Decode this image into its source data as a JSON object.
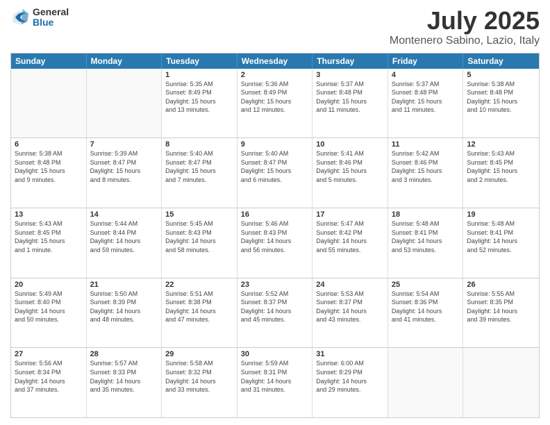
{
  "logo": {
    "general": "General",
    "blue": "Blue"
  },
  "title": "July 2025",
  "location": "Montenero Sabino, Lazio, Italy",
  "weekdays": [
    "Sunday",
    "Monday",
    "Tuesday",
    "Wednesday",
    "Thursday",
    "Friday",
    "Saturday"
  ],
  "weeks": [
    [
      {
        "day": "",
        "info": ""
      },
      {
        "day": "",
        "info": ""
      },
      {
        "day": "1",
        "info": "Sunrise: 5:35 AM\nSunset: 8:49 PM\nDaylight: 15 hours\nand 13 minutes."
      },
      {
        "day": "2",
        "info": "Sunrise: 5:36 AM\nSunset: 8:49 PM\nDaylight: 15 hours\nand 12 minutes."
      },
      {
        "day": "3",
        "info": "Sunrise: 5:37 AM\nSunset: 8:48 PM\nDaylight: 15 hours\nand 11 minutes."
      },
      {
        "day": "4",
        "info": "Sunrise: 5:37 AM\nSunset: 8:48 PM\nDaylight: 15 hours\nand 11 minutes."
      },
      {
        "day": "5",
        "info": "Sunrise: 5:38 AM\nSunset: 8:48 PM\nDaylight: 15 hours\nand 10 minutes."
      }
    ],
    [
      {
        "day": "6",
        "info": "Sunrise: 5:38 AM\nSunset: 8:48 PM\nDaylight: 15 hours\nand 9 minutes."
      },
      {
        "day": "7",
        "info": "Sunrise: 5:39 AM\nSunset: 8:47 PM\nDaylight: 15 hours\nand 8 minutes."
      },
      {
        "day": "8",
        "info": "Sunrise: 5:40 AM\nSunset: 8:47 PM\nDaylight: 15 hours\nand 7 minutes."
      },
      {
        "day": "9",
        "info": "Sunrise: 5:40 AM\nSunset: 8:47 PM\nDaylight: 15 hours\nand 6 minutes."
      },
      {
        "day": "10",
        "info": "Sunrise: 5:41 AM\nSunset: 8:46 PM\nDaylight: 15 hours\nand 5 minutes."
      },
      {
        "day": "11",
        "info": "Sunrise: 5:42 AM\nSunset: 8:46 PM\nDaylight: 15 hours\nand 3 minutes."
      },
      {
        "day": "12",
        "info": "Sunrise: 5:43 AM\nSunset: 8:45 PM\nDaylight: 15 hours\nand 2 minutes."
      }
    ],
    [
      {
        "day": "13",
        "info": "Sunrise: 5:43 AM\nSunset: 8:45 PM\nDaylight: 15 hours\nand 1 minute."
      },
      {
        "day": "14",
        "info": "Sunrise: 5:44 AM\nSunset: 8:44 PM\nDaylight: 14 hours\nand 59 minutes."
      },
      {
        "day": "15",
        "info": "Sunrise: 5:45 AM\nSunset: 8:43 PM\nDaylight: 14 hours\nand 58 minutes."
      },
      {
        "day": "16",
        "info": "Sunrise: 5:46 AM\nSunset: 8:43 PM\nDaylight: 14 hours\nand 56 minutes."
      },
      {
        "day": "17",
        "info": "Sunrise: 5:47 AM\nSunset: 8:42 PM\nDaylight: 14 hours\nand 55 minutes."
      },
      {
        "day": "18",
        "info": "Sunrise: 5:48 AM\nSunset: 8:41 PM\nDaylight: 14 hours\nand 53 minutes."
      },
      {
        "day": "19",
        "info": "Sunrise: 5:48 AM\nSunset: 8:41 PM\nDaylight: 14 hours\nand 52 minutes."
      }
    ],
    [
      {
        "day": "20",
        "info": "Sunrise: 5:49 AM\nSunset: 8:40 PM\nDaylight: 14 hours\nand 50 minutes."
      },
      {
        "day": "21",
        "info": "Sunrise: 5:50 AM\nSunset: 8:39 PM\nDaylight: 14 hours\nand 48 minutes."
      },
      {
        "day": "22",
        "info": "Sunrise: 5:51 AM\nSunset: 8:38 PM\nDaylight: 14 hours\nand 47 minutes."
      },
      {
        "day": "23",
        "info": "Sunrise: 5:52 AM\nSunset: 8:37 PM\nDaylight: 14 hours\nand 45 minutes."
      },
      {
        "day": "24",
        "info": "Sunrise: 5:53 AM\nSunset: 8:37 PM\nDaylight: 14 hours\nand 43 minutes."
      },
      {
        "day": "25",
        "info": "Sunrise: 5:54 AM\nSunset: 8:36 PM\nDaylight: 14 hours\nand 41 minutes."
      },
      {
        "day": "26",
        "info": "Sunrise: 5:55 AM\nSunset: 8:35 PM\nDaylight: 14 hours\nand 39 minutes."
      }
    ],
    [
      {
        "day": "27",
        "info": "Sunrise: 5:56 AM\nSunset: 8:34 PM\nDaylight: 14 hours\nand 37 minutes."
      },
      {
        "day": "28",
        "info": "Sunrise: 5:57 AM\nSunset: 8:33 PM\nDaylight: 14 hours\nand 35 minutes."
      },
      {
        "day": "29",
        "info": "Sunrise: 5:58 AM\nSunset: 8:32 PM\nDaylight: 14 hours\nand 33 minutes."
      },
      {
        "day": "30",
        "info": "Sunrise: 5:59 AM\nSunset: 8:31 PM\nDaylight: 14 hours\nand 31 minutes."
      },
      {
        "day": "31",
        "info": "Sunrise: 6:00 AM\nSunset: 8:29 PM\nDaylight: 14 hours\nand 29 minutes."
      },
      {
        "day": "",
        "info": ""
      },
      {
        "day": "",
        "info": ""
      }
    ]
  ]
}
